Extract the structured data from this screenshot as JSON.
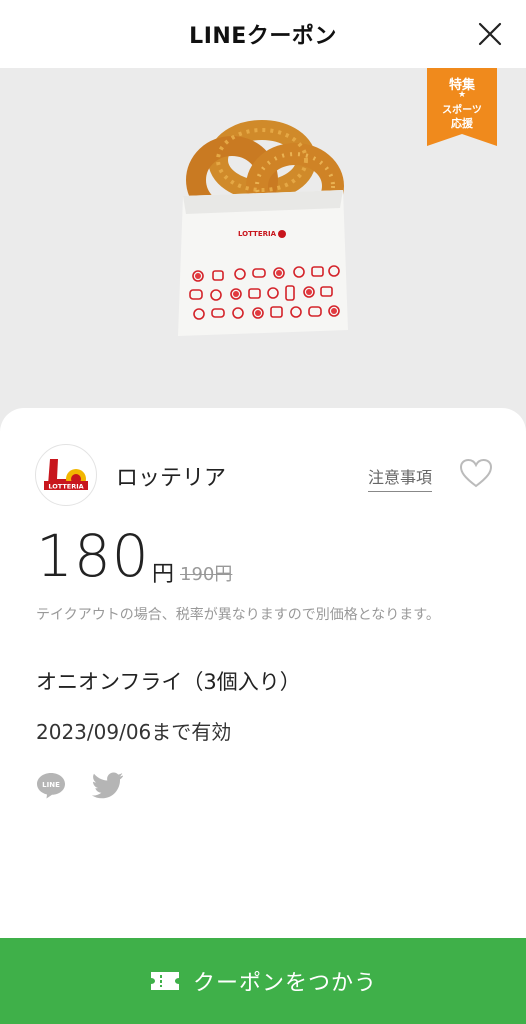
{
  "header": {
    "title": "LINEクーポン"
  },
  "badge": {
    "line1": "特集",
    "star": "★",
    "line2": "スポーツ",
    "line3": "応援",
    "color": "#f08a1c"
  },
  "coupon": {
    "shop_name": "ロッテリア",
    "logo_text": "LOTTERIA",
    "notice_label": "注意事項",
    "price": "180",
    "price_unit": "円",
    "original_price": "190円",
    "tax_note": "テイクアウトの場合、税率が異なりますので別価格となります。",
    "item_name": "オニオンフライ（3個入り）",
    "expiry": "2023/09/06まで有効"
  },
  "product_image": {
    "bag_brand": "LOTTERIA"
  },
  "share": {
    "line_label": "LINE"
  },
  "action": {
    "label": "クーポンをつかう",
    "color": "#3fb049"
  }
}
